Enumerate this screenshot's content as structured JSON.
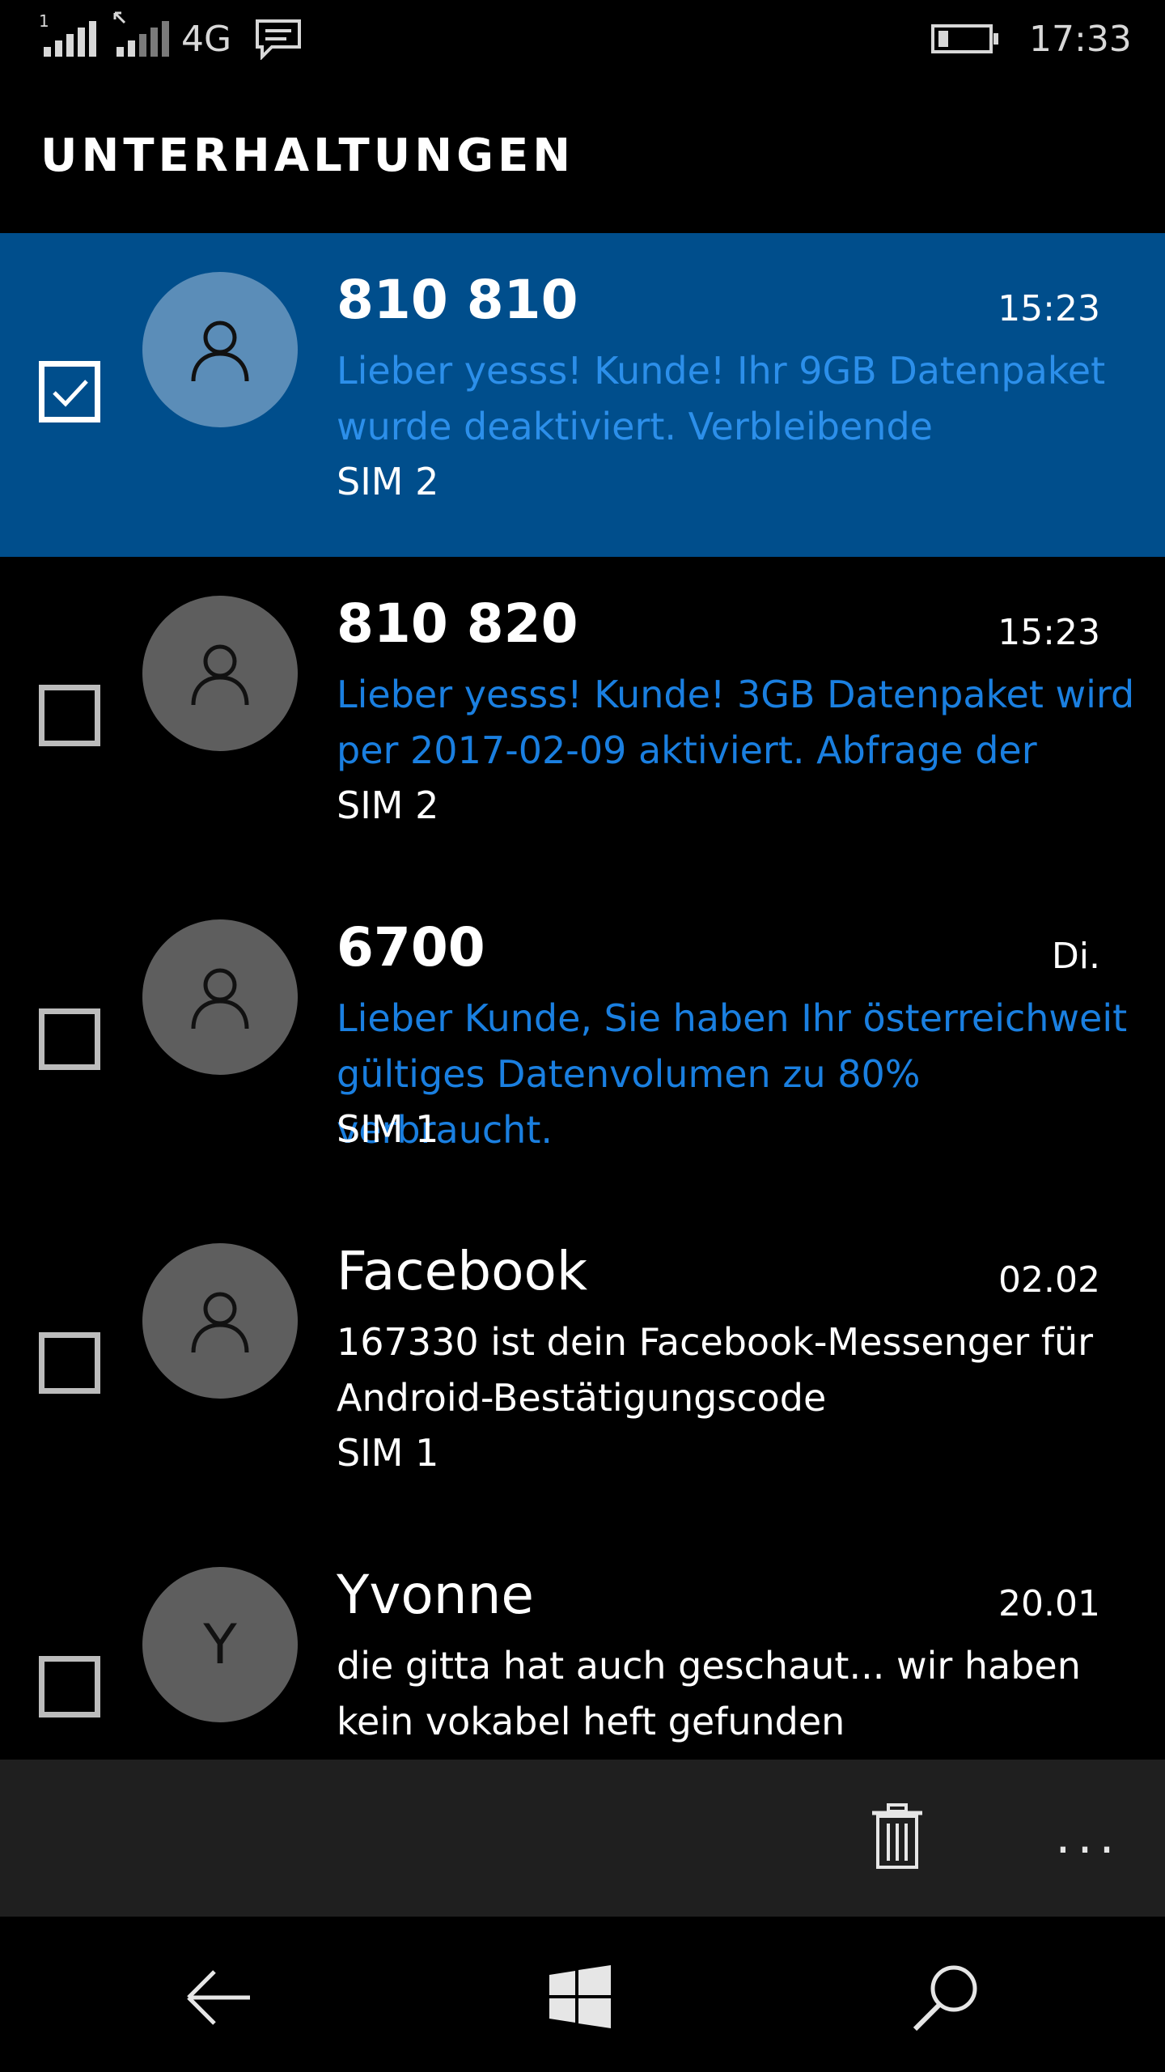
{
  "status_bar": {
    "sim1_label": "1",
    "network_type": "4G",
    "time": "17:33"
  },
  "header": {
    "title": "UNTERHALTUNGEN"
  },
  "conversations": [
    {
      "name": "810 810",
      "time": "15:23",
      "preview_line1": "Lieber yesss! Kunde! Ihr 9GB Datenpaket",
      "preview_line2": "wurde deaktiviert. Verbleibende",
      "sim": "SIM 2",
      "unread": true,
      "selected": true,
      "checked": true,
      "avatar": "person-icon"
    },
    {
      "name": "810 820",
      "time": "15:23",
      "preview_line1": "Lieber yesss! Kunde! 3GB Datenpaket wird",
      "preview_line2": "per 2017-02-09 aktiviert. Abfrage der",
      "sim": "SIM 2",
      "unread": true,
      "selected": false,
      "checked": false,
      "avatar": "person-icon"
    },
    {
      "name": "6700",
      "time": "Di.",
      "preview_line1": "Lieber Kunde, Sie haben Ihr österreichweit",
      "preview_line2": "gültiges Datenvolumen zu 80% verbraucht.",
      "sim": "SIM 1",
      "unread": true,
      "selected": false,
      "checked": false,
      "avatar": "person-icon"
    },
    {
      "name": "Facebook",
      "time": "02.02",
      "preview_line1": "167330 ist dein Facebook-Messenger für",
      "preview_line2": "Android-Bestätigungscode",
      "sim": "SIM 1",
      "unread": false,
      "selected": false,
      "checked": false,
      "avatar": "person-icon"
    },
    {
      "name": "Yvonne",
      "time": "20.01",
      "preview_line1": "die gitta hat auch geschaut... wir haben",
      "preview_line2": "kein vokabel heft gefunden",
      "sim": "",
      "unread": false,
      "selected": false,
      "checked": false,
      "avatar_letter": "Y"
    }
  ],
  "app_bar": {
    "delete_icon": "trash-icon",
    "more_label": "..."
  },
  "nav_bar": {
    "back_icon": "back-arrow-icon",
    "home_icon": "windows-logo-icon",
    "search_icon": "search-icon"
  },
  "colors": {
    "accent_selected": "#004e8c",
    "unread_text": "#1a7fe0",
    "avatar_bg": "#5e5e5e",
    "appbar_bg": "#1f1f1f"
  }
}
